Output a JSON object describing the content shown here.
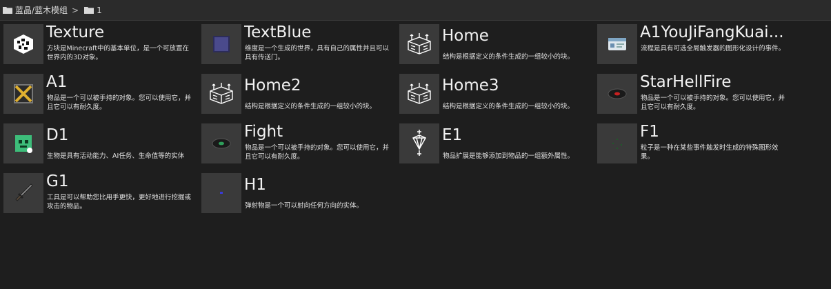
{
  "breadcrumb": {
    "segments": [
      "蓝晶/蓝木模组",
      "1"
    ],
    "separator": ">"
  },
  "items": [
    {
      "title": "Texture",
      "desc": "方块是Minecraft中的基本单位，是一个可放置在世界内的3D对象。",
      "icon": "block-icon"
    },
    {
      "title": "TextBlue",
      "desc": "维度是一个生成的世界，具有自己的属性并且可以具有传送门。",
      "icon": "dimension-icon"
    },
    {
      "title": "Home",
      "desc": "结构是根据定义的条件生成的一组较小的块。",
      "icon": "structure-icon"
    },
    {
      "title": "A1YouJiFangKuai...",
      "desc": "流程是具有可选全局触发器的图形化设计的事件。",
      "icon": "procedure-icon"
    },
    {
      "title": "A1",
      "desc": "物品是一个可以被手持的对象。您可以使用它，并且它可以有耐久度。",
      "icon": "item-icon"
    },
    {
      "title": "Home2",
      "desc": "结构是根据定义的条件生成的一组较小的块。",
      "icon": "structure-icon"
    },
    {
      "title": "Home3",
      "desc": "结构是根据定义的条件生成的一组较小的块。",
      "icon": "structure-icon"
    },
    {
      "title": "StarHellFire",
      "desc": "物品是一个可以被手持的对象。您可以使用它，并且它可以有耐久度。",
      "icon": "item-disc-icon"
    },
    {
      "title": "D1",
      "desc": "生物是具有活动能力、AI任务、生命值等的实体",
      "icon": "mob-icon"
    },
    {
      "title": "Fight",
      "desc": "物品是一个可以被手持的对象。您可以使用它，并且它可以有耐久度。",
      "icon": "item-disc-green-icon"
    },
    {
      "title": "E1",
      "desc": "物品扩展是能够添加到物品的一组额外属性。",
      "icon": "item-extension-icon"
    },
    {
      "title": "F1",
      "desc": "粒子是一种在某些事件触发时生成的特殊图形效果。",
      "icon": "particle-icon"
    },
    {
      "title": "G1",
      "desc": "工具是可以帮助您比用手更快，更好地进行挖掘或攻击的物品。",
      "icon": "tool-icon"
    },
    {
      "title": "H1",
      "desc": "弹射物是一个可以射向任何方向的实体。",
      "icon": "projectile-icon"
    }
  ],
  "colors": {
    "background": "#1e1e1e",
    "tile_thumb": "#3a3a3a",
    "breadcrumb_bar": "#2b2b2b"
  }
}
